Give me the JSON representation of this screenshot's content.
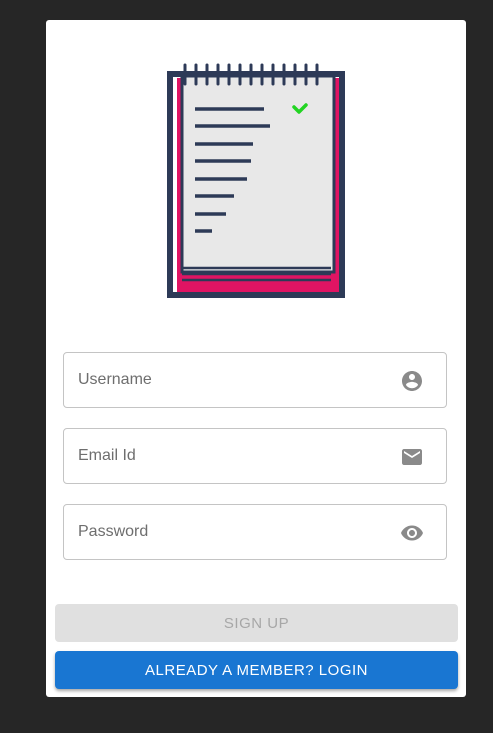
{
  "form": {
    "username": {
      "value": "",
      "placeholder": "Username",
      "icon": "account-circle-icon"
    },
    "email": {
      "value": "",
      "placeholder": "Email Id",
      "icon": "mail-icon"
    },
    "password": {
      "value": "",
      "placeholder": "Password",
      "icon": "eye-icon"
    }
  },
  "buttons": {
    "signup_label": "SIGN UP",
    "login_label": "ALREADY A MEMBER? LOGIN"
  },
  "colors": {
    "background": "#262626",
    "card": "#ffffff",
    "notepad_outline": "#2d3a57",
    "notepad_accent": "#e01463",
    "check": "#22d422",
    "login_button": "#1976d2",
    "signup_button_disabled": "#e0e0e0"
  }
}
